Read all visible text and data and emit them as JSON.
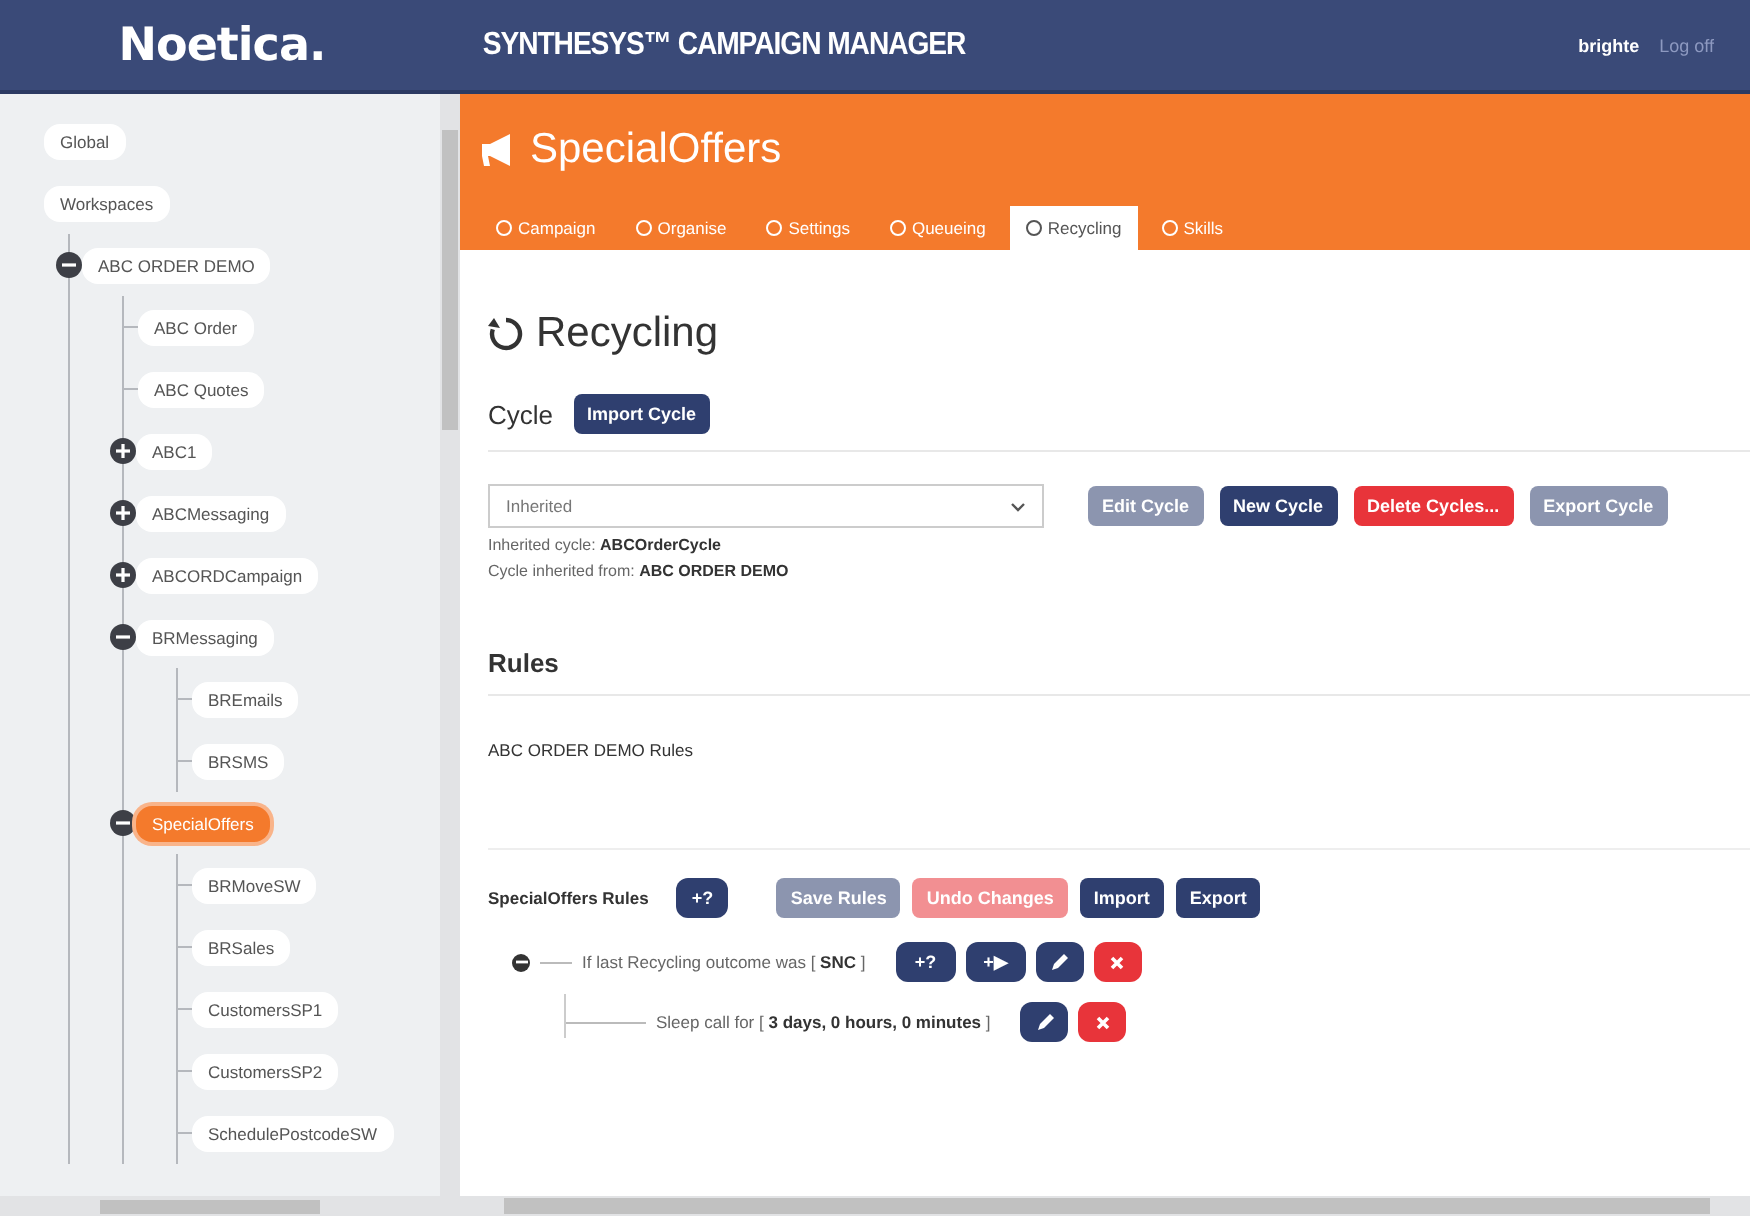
{
  "header": {
    "logo": "Noetica.",
    "product": "SYNTHESYS™ CAMPAIGN MANAGER",
    "user": "brighte",
    "logout": "Log off"
  },
  "tree": [
    {
      "label": "Global",
      "selected": false
    },
    {
      "label": "Workspaces",
      "selected": false,
      "children": [
        {
          "label": "ABC ORDER DEMO",
          "selected": false,
          "expanded": true,
          "children": [
            {
              "label": "ABC Order",
              "selected": false
            },
            {
              "label": "ABC Quotes",
              "selected": false
            },
            {
              "label": "ABC1",
              "selected": false,
              "expanded": false
            },
            {
              "label": "ABCMessaging",
              "selected": false,
              "expanded": false
            },
            {
              "label": "ABCORDCampaign",
              "selected": false,
              "expanded": false
            },
            {
              "label": "BRMessaging",
              "selected": false,
              "expanded": true,
              "children": [
                {
                  "label": "BREmails",
                  "selected": false
                },
                {
                  "label": "BRSMS",
                  "selected": false
                }
              ]
            },
            {
              "label": "SpecialOffers",
              "selected": true,
              "expanded": true,
              "children": [
                {
                  "label": "BRMoveSW",
                  "selected": false
                },
                {
                  "label": "BRSales",
                  "selected": false
                },
                {
                  "label": "CustomersSP1",
                  "selected": false
                },
                {
                  "label": "CustomersSP2",
                  "selected": false
                },
                {
                  "label": "SchedulePostcodeSW",
                  "selected": false
                }
              ]
            }
          ]
        }
      ]
    }
  ],
  "campaign": {
    "title": "SpecialOffers",
    "tabs": [
      {
        "label": "Campaign",
        "selected": false
      },
      {
        "label": "Organise",
        "selected": false
      },
      {
        "label": "Settings",
        "selected": false
      },
      {
        "label": "Queueing",
        "selected": false
      },
      {
        "label": "Recycling",
        "selected": true
      },
      {
        "label": "Skills",
        "selected": false
      }
    ]
  },
  "page": {
    "title": "Recycling",
    "cycle": {
      "heading": "Cycle",
      "import_button": "Import Cycle",
      "select": {
        "value": "Inherited"
      },
      "buttons": [
        {
          "label": "Edit Cycle",
          "kind": "primary",
          "disabled": true
        },
        {
          "label": "New Cycle",
          "kind": "primary",
          "disabled": false
        },
        {
          "label": "Delete Cycles...",
          "kind": "danger",
          "disabled": false
        },
        {
          "label": "Export Cycle",
          "kind": "primary",
          "disabled": true
        }
      ],
      "info": [
        "Inherited cycle: **ABCOrderCycle**",
        "Cycle inherited from: **ABC ORDER DEMO**"
      ]
    },
    "rules": {
      "heading": "Rules",
      "inherited_title": "ABC ORDER DEMO Rules",
      "own_title": "SpecialOffers Rules",
      "add_button": "+?",
      "buttons": [
        {
          "label": "Save Rules",
          "kind": "primary",
          "disabled": true
        },
        {
          "label": "Undo Changes",
          "kind": "danger",
          "disabled": true
        },
        {
          "label": "Import",
          "kind": "primary",
          "disabled": false
        },
        {
          "label": "Export",
          "kind": "primary",
          "disabled": false
        }
      ],
      "tree": [
        {
          "text": "If last Recycling outcome was [ **SNC** ]",
          "expanded": true,
          "actions": [
            {
              "kind": "text",
              "label": "+?"
            },
            {
              "kind": "text",
              "label": "+▶"
            },
            {
              "kind": "edit"
            },
            {
              "kind": "delete"
            }
          ],
          "children": [
            {
              "text": "Sleep call for [ **3 days, 0 hours, 0 minutes** ]",
              "actions": [
                {
                  "kind": "edit"
                },
                {
                  "kind": "delete"
                }
              ]
            }
          ]
        }
      ]
    }
  }
}
